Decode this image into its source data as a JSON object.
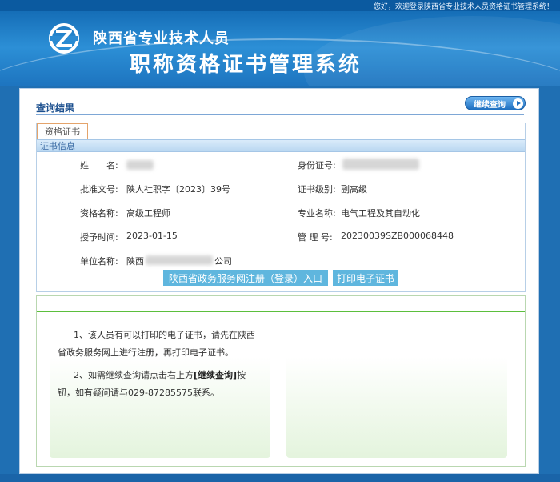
{
  "header": {
    "welcome": "您好，欢迎登录陕西省专业技术人员资格证书管理系统！",
    "title_line1": "陕西省专业技术人员",
    "title_line2": "职称资格证书管理系统"
  },
  "result": {
    "title": "查询结果",
    "continue_label": "继续查询"
  },
  "cert": {
    "tab_label": "资格证书",
    "section_label": "证书信息",
    "fields": {
      "name_label": "姓　　名:",
      "id_label": "身份证号:",
      "approval_label": "批准文号:",
      "approval_value": "陕人社职字〔2023〕39号",
      "level_label": "证书级别:",
      "level_value": "副高级",
      "qual_label": "资格名称:",
      "qual_value": "高级工程师",
      "major_label": "专业名称:",
      "major_value": "电气工程及其自动化",
      "date_label": "授予时间:",
      "date_value": "2023-01-15",
      "mgmt_label": "管 理 号:",
      "mgmt_value": "20230039SZB000068448",
      "unit_label": "单位名称:",
      "unit_prefix": "陕西",
      "unit_suffix": "公司"
    },
    "gov_button": "陕西省政务服务网注册（登录）入口",
    "print_button": "打印电子证书"
  },
  "notice": {
    "line1a": "1、该人员有可以打印的电子证书，请先在陕西",
    "line1b": "省政务服务网上进行注册，再打印电子证书。",
    "line2a_pre": "2、如需继续查询请点击右上方",
    "line2a_bold": "[继续查询]",
    "line2a_post": "按",
    "line2b": "钮，如有疑问请与029-87285575联系。"
  },
  "colors": {
    "accent": "#1d6fc0",
    "button": "#5fb6de",
    "notice_line": "#5bbf3d"
  }
}
